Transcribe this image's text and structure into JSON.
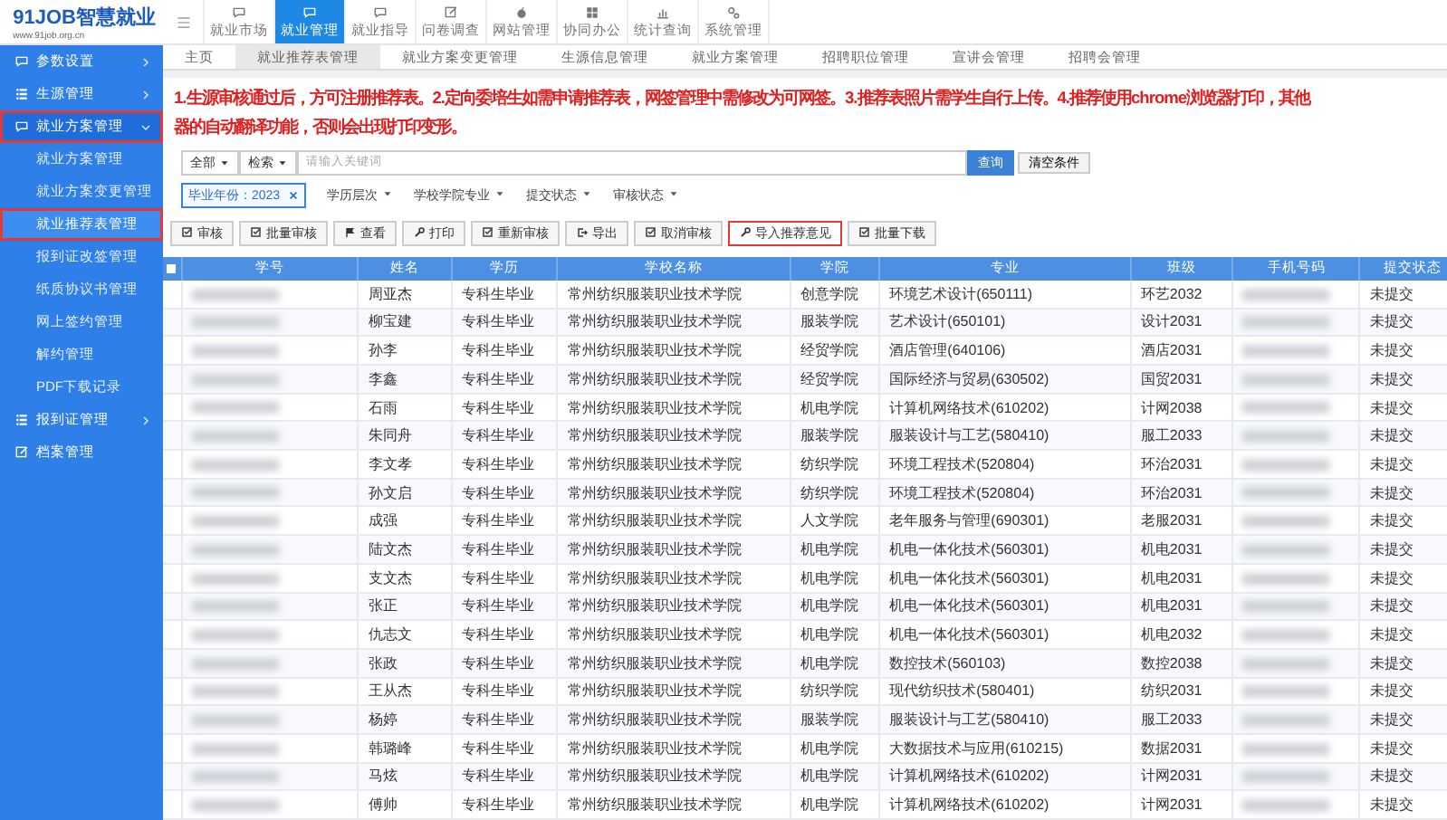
{
  "logo": {
    "title": "91JOB智慧就业",
    "subtitle": "www.91job.org.cn"
  },
  "top_nav": [
    {
      "label": "就业市场",
      "selected": false
    },
    {
      "label": "就业管理",
      "selected": true
    },
    {
      "label": "就业指导",
      "selected": false
    },
    {
      "label": "问卷调查",
      "selected": false
    },
    {
      "label": "网站管理",
      "selected": false
    },
    {
      "label": "协同办公",
      "selected": false
    },
    {
      "label": "统计查询",
      "selected": false
    },
    {
      "label": "系统管理",
      "selected": false
    }
  ],
  "sidebar": {
    "items": [
      {
        "label": "参数设置",
        "expanded": false,
        "highlighted": false
      },
      {
        "label": "生源管理",
        "expanded": false,
        "highlighted": false
      },
      {
        "label": "就业方案管理",
        "expanded": true,
        "highlighted": true,
        "children": [
          {
            "label": "就业方案管理",
            "selected": false,
            "highlighted": false
          },
          {
            "label": "就业方案变更管理",
            "selected": false,
            "highlighted": false
          },
          {
            "label": "就业推荐表管理",
            "selected": true,
            "highlighted": true
          },
          {
            "label": "报到证改签管理",
            "selected": false,
            "highlighted": false
          },
          {
            "label": "纸质协议书管理",
            "selected": false,
            "highlighted": false
          },
          {
            "label": "网上签约管理",
            "selected": false,
            "highlighted": false
          },
          {
            "label": "解约管理",
            "selected": false,
            "highlighted": false
          },
          {
            "label": "PDF下载记录",
            "selected": false,
            "highlighted": false
          }
        ]
      },
      {
        "label": "报到证管理",
        "expanded": false,
        "highlighted": false
      },
      {
        "label": "档案管理",
        "expanded": false,
        "highlighted": false
      }
    ]
  },
  "tabs": [
    {
      "label": "主页",
      "selected": false
    },
    {
      "label": "就业推荐表管理",
      "selected": true
    },
    {
      "label": "就业方案变更管理",
      "selected": false
    },
    {
      "label": "生源信息管理",
      "selected": false
    },
    {
      "label": "就业方案管理",
      "selected": false
    },
    {
      "label": "招聘职位管理",
      "selected": false
    },
    {
      "label": "宣讲会管理",
      "selected": false
    },
    {
      "label": "招聘会管理",
      "selected": false
    }
  ],
  "notice": [
    "1.生源审核通过后，方可注册推荐表。2.定向委培生如需申请推荐表，网签管理中需修改为可网签。3.推荐表照片需学生自行上传。4.推荐使用chrome浏览器打印，其他",
    "器的自动翻译功能，否则会出现打印变形。"
  ],
  "search": {
    "scope": "全部",
    "field": "检索",
    "placeholder": "请输入关键词",
    "submit": "查询",
    "clear": "清空条件"
  },
  "filters": {
    "tags": [
      {
        "label": "毕业年份：2023"
      }
    ],
    "dropdowns": [
      "学历层次",
      "学校学院专业",
      "提交状态",
      "审核状态"
    ]
  },
  "toolbar": [
    {
      "label": "审核",
      "highlighted": false
    },
    {
      "label": "批量审核",
      "highlighted": false
    },
    {
      "label": "查看",
      "highlighted": false
    },
    {
      "label": "打印",
      "highlighted": false
    },
    {
      "label": "重新审核",
      "highlighted": false
    },
    {
      "label": "导出",
      "highlighted": false
    },
    {
      "label": "取消审核",
      "highlighted": false
    },
    {
      "label": "导入推荐意见",
      "highlighted": true
    },
    {
      "label": "批量下载",
      "highlighted": false
    }
  ],
  "table": {
    "select_all_checked": false,
    "columns": [
      "学号",
      "姓名",
      "学历",
      "学校名称",
      "学院",
      "专业",
      "班级",
      "手机号码",
      "提交状态"
    ],
    "rows": [
      [
        "",
        "周亚杰",
        "专科生毕业",
        "常州纺织服装职业技术学院",
        "创意学院",
        "环境艺术设计(650111)",
        "环艺2032",
        "",
        "未提交"
      ],
      [
        "",
        "柳宝建",
        "专科生毕业",
        "常州纺织服装职业技术学院",
        "服装学院",
        "艺术设计(650101)",
        "设计2031",
        "",
        "未提交"
      ],
      [
        "",
        "孙李",
        "专科生毕业",
        "常州纺织服装职业技术学院",
        "经贸学院",
        "酒店管理(640106)",
        "酒店2031",
        "",
        "未提交"
      ],
      [
        "",
        "李鑫",
        "专科生毕业",
        "常州纺织服装职业技术学院",
        "经贸学院",
        "国际经济与贸易(630502)",
        "国贸2031",
        "",
        "未提交"
      ],
      [
        "",
        "石雨",
        "专科生毕业",
        "常州纺织服装职业技术学院",
        "机电学院",
        "计算机网络技术(610202)",
        "计网2038",
        "",
        "未提交"
      ],
      [
        "",
        "朱同舟",
        "专科生毕业",
        "常州纺织服装职业技术学院",
        "服装学院",
        "服装设计与工艺(580410)",
        "服工2033",
        "",
        "未提交"
      ],
      [
        "",
        "李文孝",
        "专科生毕业",
        "常州纺织服装职业技术学院",
        "纺织学院",
        "环境工程技术(520804)",
        "环治2031",
        "",
        "未提交"
      ],
      [
        "",
        "孙文启",
        "专科生毕业",
        "常州纺织服装职业技术学院",
        "纺织学院",
        "环境工程技术(520804)",
        "环治2031",
        "",
        "未提交"
      ],
      [
        "",
        "成强",
        "专科生毕业",
        "常州纺织服装职业技术学院",
        "人文学院",
        "老年服务与管理(690301)",
        "老服2031",
        "",
        "未提交"
      ],
      [
        "",
        "陆文杰",
        "专科生毕业",
        "常州纺织服装职业技术学院",
        "机电学院",
        "机电一体化技术(560301)",
        "机电2031",
        "",
        "未提交"
      ],
      [
        "",
        "支文杰",
        "专科生毕业",
        "常州纺织服装职业技术学院",
        "机电学院",
        "机电一体化技术(560301)",
        "机电2031",
        "",
        "未提交"
      ],
      [
        "",
        "张正",
        "专科生毕业",
        "常州纺织服装职业技术学院",
        "机电学院",
        "机电一体化技术(560301)",
        "机电2031",
        "",
        "未提交"
      ],
      [
        "",
        "仇志文",
        "专科生毕业",
        "常州纺织服装职业技术学院",
        "机电学院",
        "机电一体化技术(560301)",
        "机电2032",
        "",
        "未提交"
      ],
      [
        "",
        "张政",
        "专科生毕业",
        "常州纺织服装职业技术学院",
        "机电学院",
        "数控技术(560103)",
        "数控2038",
        "",
        "未提交"
      ],
      [
        "",
        "王从杰",
        "专科生毕业",
        "常州纺织服装职业技术学院",
        "纺织学院",
        "现代纺织技术(580401)",
        "纺织2031",
        "",
        "未提交"
      ],
      [
        "",
        "杨婷",
        "专科生毕业",
        "常州纺织服装职业技术学院",
        "服装学院",
        "服装设计与工艺(580410)",
        "服工2033",
        "",
        "未提交"
      ],
      [
        "",
        "韩璐峰",
        "专科生毕业",
        "常州纺织服装职业技术学院",
        "机电学院",
        "大数据技术与应用(610215)",
        "数据2031",
        "",
        "未提交"
      ],
      [
        "",
        "马炫",
        "专科生毕业",
        "常州纺织服装职业技术学院",
        "机电学院",
        "计算机网络技术(610202)",
        "计网2031",
        "",
        "未提交"
      ],
      [
        "",
        "傅帅",
        "专科生毕业",
        "常州纺织服装职业技术学院",
        "机电学院",
        "计算机网络技术(610202)",
        "计网2031",
        "",
        "未提交"
      ]
    ]
  }
}
